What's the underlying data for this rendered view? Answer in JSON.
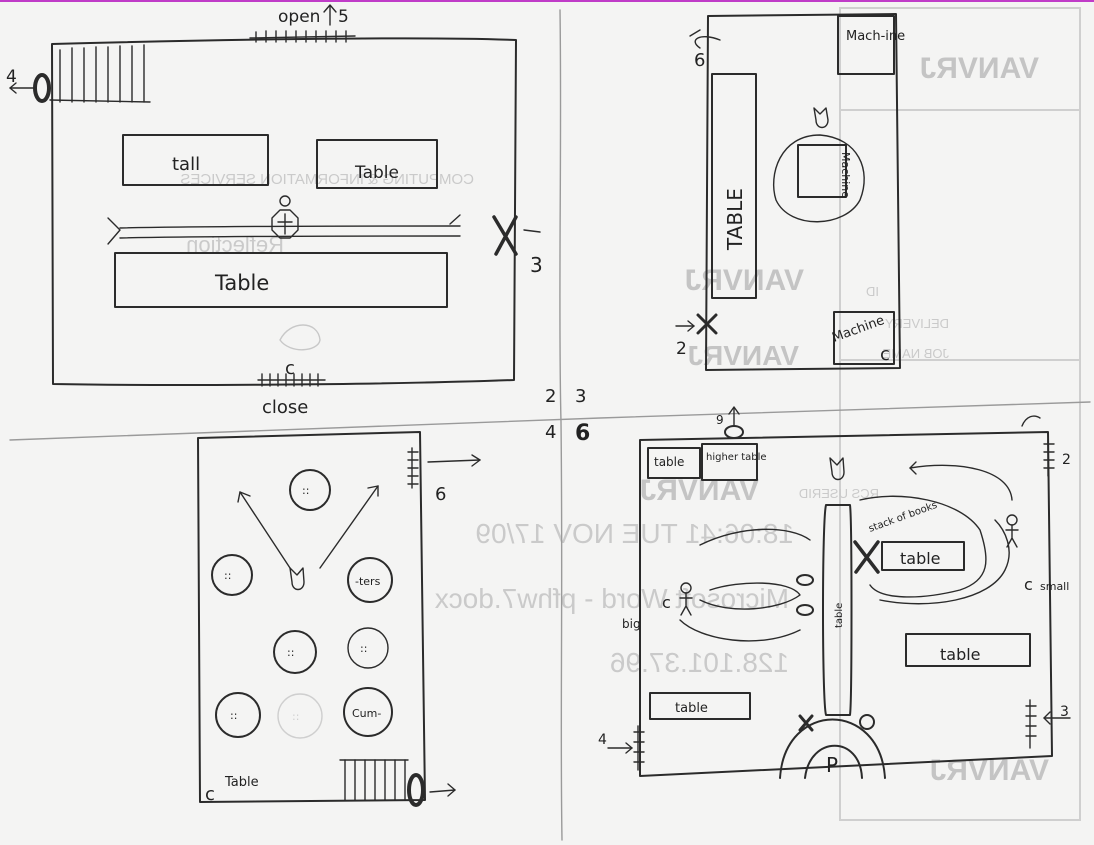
{
  "sketch": {
    "top_left": {
      "open_label": "open",
      "open_count": "5",
      "door_left_number": "4",
      "door_right_number": "3",
      "tables": [
        "tall",
        "Table",
        "Table"
      ],
      "pawn_marker": "c",
      "close_label": "close"
    },
    "top_right": {
      "exit_number": "6",
      "machine_top": "Mach-ine",
      "machine_center": "Machine",
      "table_vertical": "TABLE",
      "machine_bottom": "Machine",
      "entry_number": "2",
      "pawn_marker": "c"
    },
    "center": {
      "row1": [
        "2",
        "3"
      ],
      "row2": [
        "4",
        "6"
      ]
    },
    "bottom_left": {
      "circles": [
        "::",
        "::",
        "::",
        "-ters",
        "::",
        "::",
        "::",
        "Cum-"
      ],
      "exit_number": "6",
      "table_label": "Table",
      "pawn_marker": "c"
    },
    "bottom_right": {
      "top_exit_number": "9",
      "table_top_left": "table",
      "higher_table": "higher table",
      "stack_label": "stack of books",
      "table_center": "table",
      "label_big": "big",
      "label_small": "small",
      "table_right": "table",
      "table_bottom_left": "table",
      "vertical_table": "table",
      "exit_right_number": "3",
      "exit_left_number": "4",
      "exit_top_right_number": "2",
      "gate_label": "P",
      "pawn_markers": [
        "c",
        "c"
      ]
    },
    "watermark": {
      "brand": "VANVRJ",
      "services": "COMPUTING & INFORMATION SERVICES",
      "reflection": "Reflection",
      "delivery": "DELIVERY",
      "jobname": "JOB NAME",
      "id": "ID",
      "userid": "RCS USERID",
      "timestamp": "18:06:41 TUE NOV 17/09",
      "document": "Microsoft Word - pfhw7.docx",
      "ip": "128.101.37.96"
    }
  }
}
